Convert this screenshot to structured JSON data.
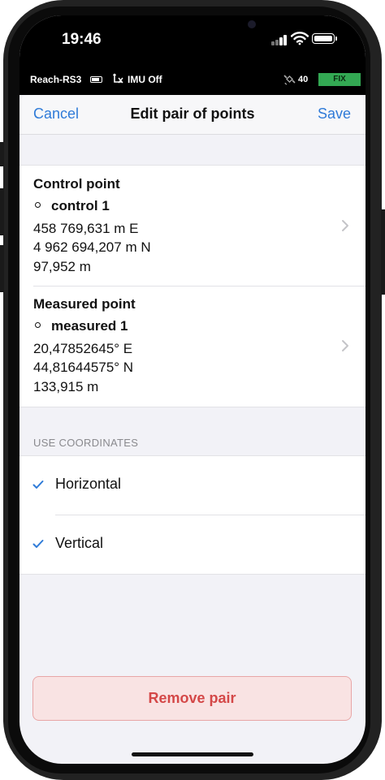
{
  "status_bar": {
    "time": "19:46"
  },
  "reach_bar": {
    "device_name": "Reach-RS3",
    "imu_status": "IMU Off",
    "satellites": "40",
    "fix_status": "FIX",
    "fix_color": "#33a853"
  },
  "navbar": {
    "cancel_label": "Cancel",
    "title": "Edit pair of points",
    "save_label": "Save",
    "accent_color": "#2f7bd8"
  },
  "control_point": {
    "title": "Control point",
    "name": "control 1",
    "easting": "458 769,631 m E",
    "northing": "4 962 694,207 m N",
    "elevation": "97,952 m"
  },
  "measured_point": {
    "title": "Measured point",
    "name": "measured 1",
    "latitude": "20,47852645° E",
    "longitude": "44,81644575° N",
    "elevation": "133,915 m"
  },
  "use_coordinates": {
    "header": "USE COORDINATES",
    "options": [
      {
        "label": "Horizontal",
        "checked": true
      },
      {
        "label": "Vertical",
        "checked": true
      }
    ]
  },
  "remove_button": {
    "label": "Remove pair",
    "color": "#d44848"
  },
  "icons": [
    "battery-icon",
    "imu-icon",
    "satellite-icon",
    "wifi-icon",
    "signal-icon",
    "chevron-right-icon",
    "checkmark-icon"
  ]
}
